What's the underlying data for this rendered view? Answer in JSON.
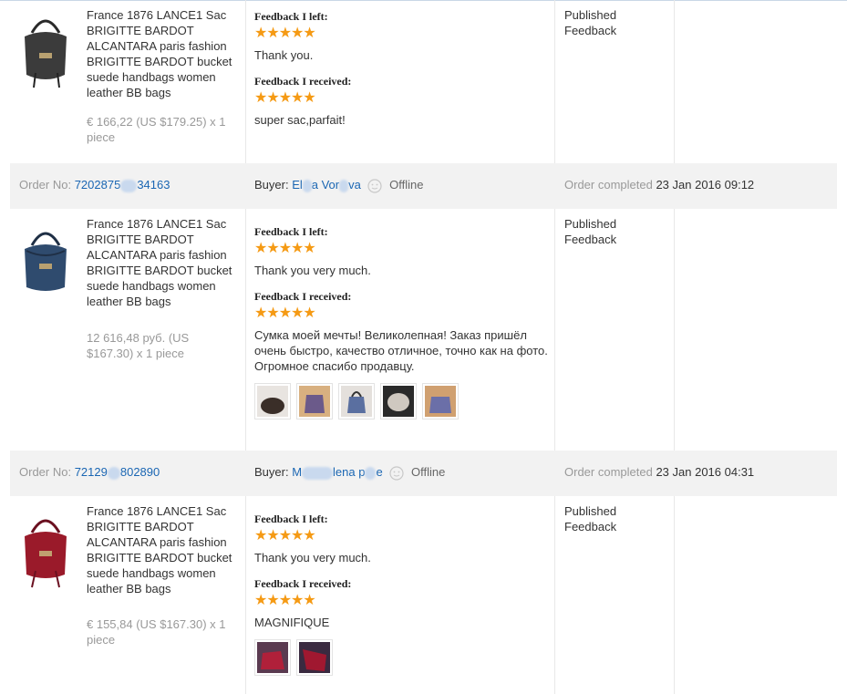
{
  "items": [
    {
      "title": "France 1876 LANCE1 Sac BRIGITTE BARDOT ALCANTARA paris fashion BRIGITTE BARDOT bucket suede handbags women leather BB bags",
      "price": "€ 166,22 (US $179.25) x 1 piece",
      "feedback_left_label": "Feedback I left:",
      "feedback_left_stars": "★★★★★",
      "feedback_left_text": "Thank you.",
      "feedback_received_label": "Feedback I received:",
      "feedback_received_stars": "★★★★★",
      "feedback_received_text": "super sac,parfait!",
      "status": "Published Feedback",
      "bag_color": "#3b3b3b"
    },
    {
      "title": "France 1876 LANCE1 Sac BRIGITTE BARDOT ALCANTARA paris fashion BRIGITTE BARDOT bucket suede handbags women leather BB bags",
      "price": "12 616,48 руб. (US $167.30) x 1 piece",
      "feedback_left_label": "Feedback I left:",
      "feedback_left_stars": "★★★★★",
      "feedback_left_text": "Thank you very much.",
      "feedback_received_label": "Feedback I received:",
      "feedback_received_stars": "★★★★★",
      "feedback_received_text": "Сумка моей мечты! Великолепная! Заказ пришёл очень быстро, качество отличное, точно как на фото. Огромное спасибо продавцу.",
      "status": "Published Feedback",
      "bag_color": "#2f4b6e",
      "photos": [
        "#3a2e28",
        "#6b5a8a",
        "#5a6fa0",
        "#4a4a4a",
        "#6b6fa8"
      ]
    },
    {
      "title": "France 1876 LANCE1 Sac BRIGITTE BARDOT ALCANTARA paris fashion BRIGITTE BARDOT bucket suede handbags women leather BB bags",
      "price": "€ 155,84 (US $167.30) x 1 piece",
      "feedback_left_label": "Feedback I left:",
      "feedback_left_stars": "★★★★★",
      "feedback_left_text": "Thank you very much.",
      "feedback_received_label": "Feedback I received:",
      "feedback_received_stars": "★★★★★",
      "feedback_received_text": "MAGNIFIQUE",
      "status": "Published Feedback",
      "bag_color": "#9a1a2a",
      "photos": [
        "#b0203a",
        "#a01830"
      ]
    }
  ],
  "orders": [
    {
      "order_label": "Order No:",
      "order_no_a": "7202875",
      "order_no_b": "34163",
      "buyer_label": "Buyer:",
      "buyer_a": "El",
      "buyer_b": "a Vor",
      "buyer_c": "va",
      "offline": "Offline",
      "completed_label": "Order completed",
      "completed_date": "23 Jan 2016 09:12"
    },
    {
      "order_label": "Order No:",
      "order_no_a": "72129",
      "order_no_b": "802890",
      "buyer_label": "Buyer:",
      "buyer_a": "M",
      "buyer_b": "lena",
      "buyer_c": "p",
      "buyer_d": "e",
      "offline": "Offline",
      "completed_label": "Order completed",
      "completed_date": "23 Jan 2016 04:31"
    }
  ],
  "colors": {
    "star": "#f59a14",
    "link": "#1a66b3",
    "bar": "#f2f2f2"
  }
}
